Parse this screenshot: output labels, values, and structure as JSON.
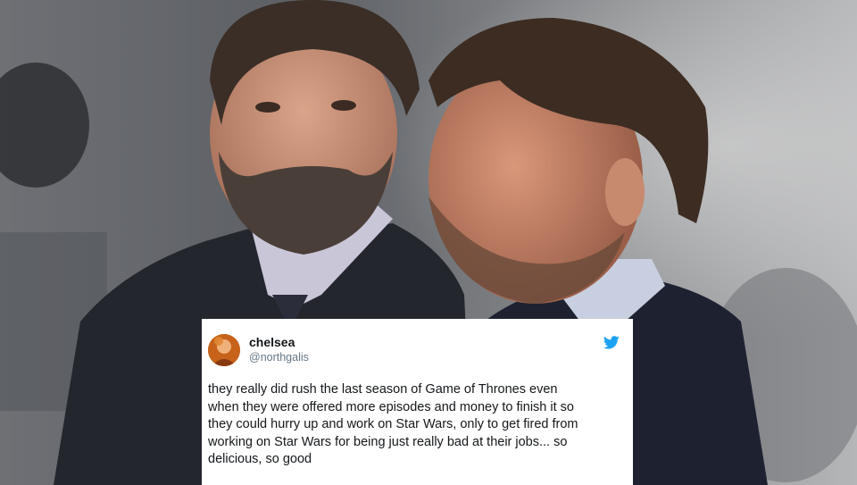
{
  "tweet": {
    "display_name": "chelsea",
    "handle": "@northgalis",
    "text": "they really did rush the last season of Game of Thrones even\nwhen they were offered more episodes and money to finish it so\nthey could hurry up and work on Star Wars, only to get fired from\nworking on Star Wars for being just really bad at their jobs... so\ndelicious, so good",
    "avatar_icon": "profile-avatar",
    "platform_icon": "twitter-bird-icon"
  },
  "colors": {
    "twitter_blue": "#1da1f2",
    "card_background": "#ffffff",
    "name_text": "#14171a",
    "handle_text": "#657786"
  }
}
